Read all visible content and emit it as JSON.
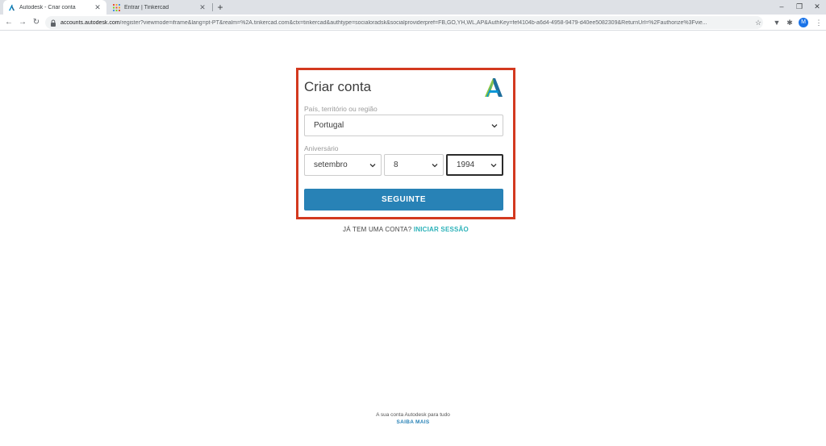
{
  "browser": {
    "tabs": [
      {
        "title": "Autodesk - Criar conta",
        "active": true
      },
      {
        "title": "Entrar | Tinkercad",
        "active": false
      }
    ],
    "url_host": "accounts.autodesk.com",
    "url_path": "/register?viewmode=iframe&lang=pt-PT&realm=%2A.tinkercad.com&ctx=tinkercad&authtype=socialoradsk&socialproviderpref=FB,GO,YH,WL,AP&AuthKey=fef4104b-a6d4-4958-9479-d40ee5082309&ReturnUrl=%2Fauthorize%3Fvie...",
    "avatar_letter": "M",
    "accent": "#1a73e8"
  },
  "form": {
    "title": "Criar conta",
    "country_label": "País, território ou região",
    "country_value": "Portugal",
    "birthday_label": "Aniversário",
    "month_value": "setembro",
    "day_value": "8",
    "year_value": "1994",
    "next_button": "SEGUINTE",
    "highlight_color": "#d3391f",
    "button_color": "#2882b6"
  },
  "signin": {
    "prompt": "JÁ TEM UMA CONTA?",
    "link": "INICIAR SESSÃO"
  },
  "footer": {
    "text": "A sua conta Autodesk para tudo",
    "link": "SAIBA MAIS"
  }
}
